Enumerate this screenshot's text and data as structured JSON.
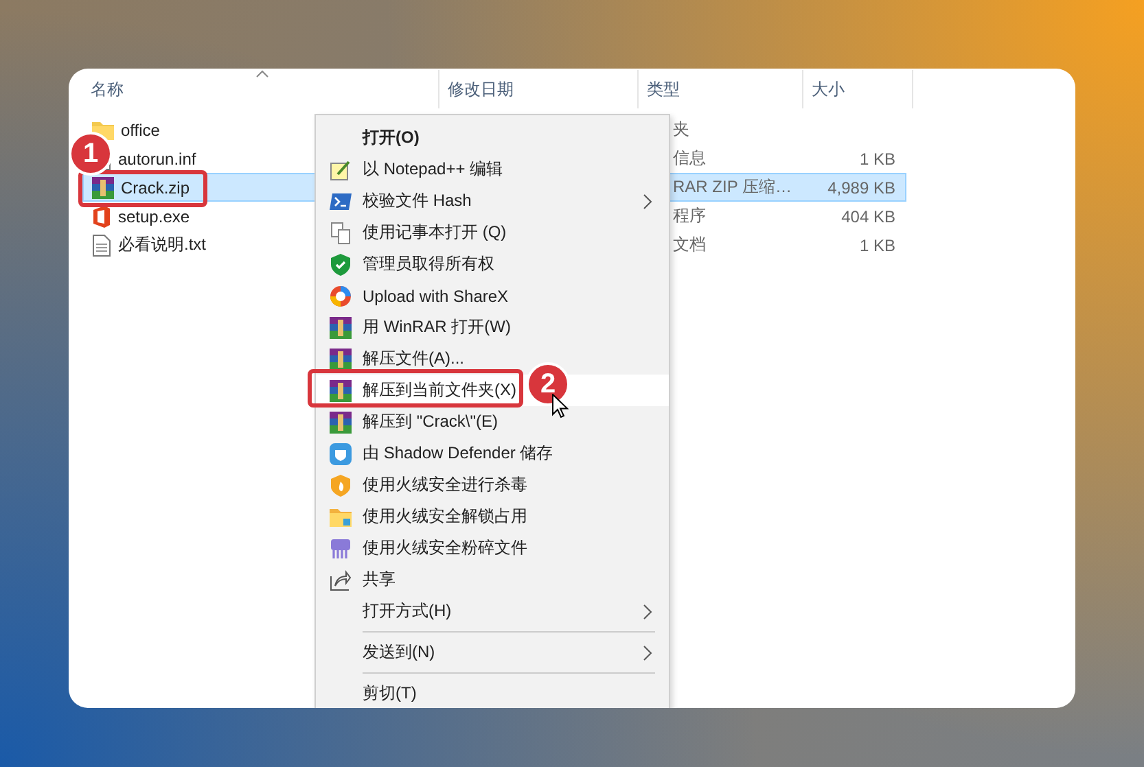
{
  "columns": [
    "名称",
    "修改日期",
    "类型",
    "大小"
  ],
  "files": [
    {
      "name": "office",
      "kind": "folder",
      "type": "夹",
      "selected": false
    },
    {
      "name": "autorun.inf",
      "kind": "inf",
      "type": "信息",
      "size": "1 KB",
      "selected": false
    },
    {
      "name": "Crack.zip",
      "kind": "zip",
      "type": "RAR ZIP 压缩…",
      "size": "4,989 KB",
      "selected": true
    },
    {
      "name": "setup.exe",
      "kind": "exe",
      "type": "程序",
      "size": "404 KB",
      "selected": false
    },
    {
      "name": "必看说明.txt",
      "kind": "txt",
      "type": "文档",
      "size": "1 KB",
      "selected": false
    }
  ],
  "context_menu": [
    {
      "kind": "item",
      "label": "打开(O)",
      "bold": true,
      "submenu": false,
      "hovered": false
    },
    {
      "kind": "item",
      "label": "以 Notepad++ 编辑",
      "bold": false,
      "submenu": false,
      "hovered": false
    },
    {
      "kind": "item",
      "label": "校验文件 Hash",
      "bold": false,
      "submenu": true,
      "hovered": false
    },
    {
      "kind": "item",
      "label": "使用记事本打开 (Q)",
      "bold": false,
      "submenu": false,
      "hovered": false
    },
    {
      "kind": "item",
      "label": "管理员取得所有权",
      "bold": false,
      "submenu": false,
      "hovered": false
    },
    {
      "kind": "item",
      "label": "Upload with ShareX",
      "bold": false,
      "submenu": false,
      "hovered": false
    },
    {
      "kind": "item",
      "label": "用 WinRAR 打开(W)",
      "bold": false,
      "submenu": false,
      "hovered": false
    },
    {
      "kind": "item",
      "label": "解压文件(A)...",
      "bold": false,
      "submenu": false,
      "hovered": false
    },
    {
      "kind": "item",
      "label": "解压到当前文件夹(X)",
      "bold": false,
      "submenu": false,
      "hovered": true
    },
    {
      "kind": "item",
      "label": "解压到 \"Crack\\\"(E)",
      "bold": false,
      "submenu": false,
      "hovered": false
    },
    {
      "kind": "item",
      "label": "由 Shadow Defender 储存",
      "bold": false,
      "submenu": false,
      "hovered": false
    },
    {
      "kind": "item",
      "label": "使用火绒安全进行杀毒",
      "bold": false,
      "submenu": false,
      "hovered": false
    },
    {
      "kind": "item",
      "label": "使用火绒安全解锁占用",
      "bold": false,
      "submenu": false,
      "hovered": false
    },
    {
      "kind": "item",
      "label": "使用火绒安全粉碎文件",
      "bold": false,
      "submenu": false,
      "hovered": false
    },
    {
      "kind": "item",
      "label": "共享",
      "bold": false,
      "submenu": false,
      "hovered": false
    },
    {
      "kind": "item",
      "label": "打开方式(H)",
      "bold": false,
      "submenu": true,
      "hovered": false
    },
    {
      "kind": "separator"
    },
    {
      "kind": "item",
      "label": "发送到(N)",
      "bold": false,
      "submenu": true,
      "hovered": false
    },
    {
      "kind": "separator"
    },
    {
      "kind": "item",
      "label": "剪切(T)",
      "bold": false,
      "submenu": false,
      "hovered": false
    }
  ],
  "annotations": [
    "1",
    "2"
  ]
}
